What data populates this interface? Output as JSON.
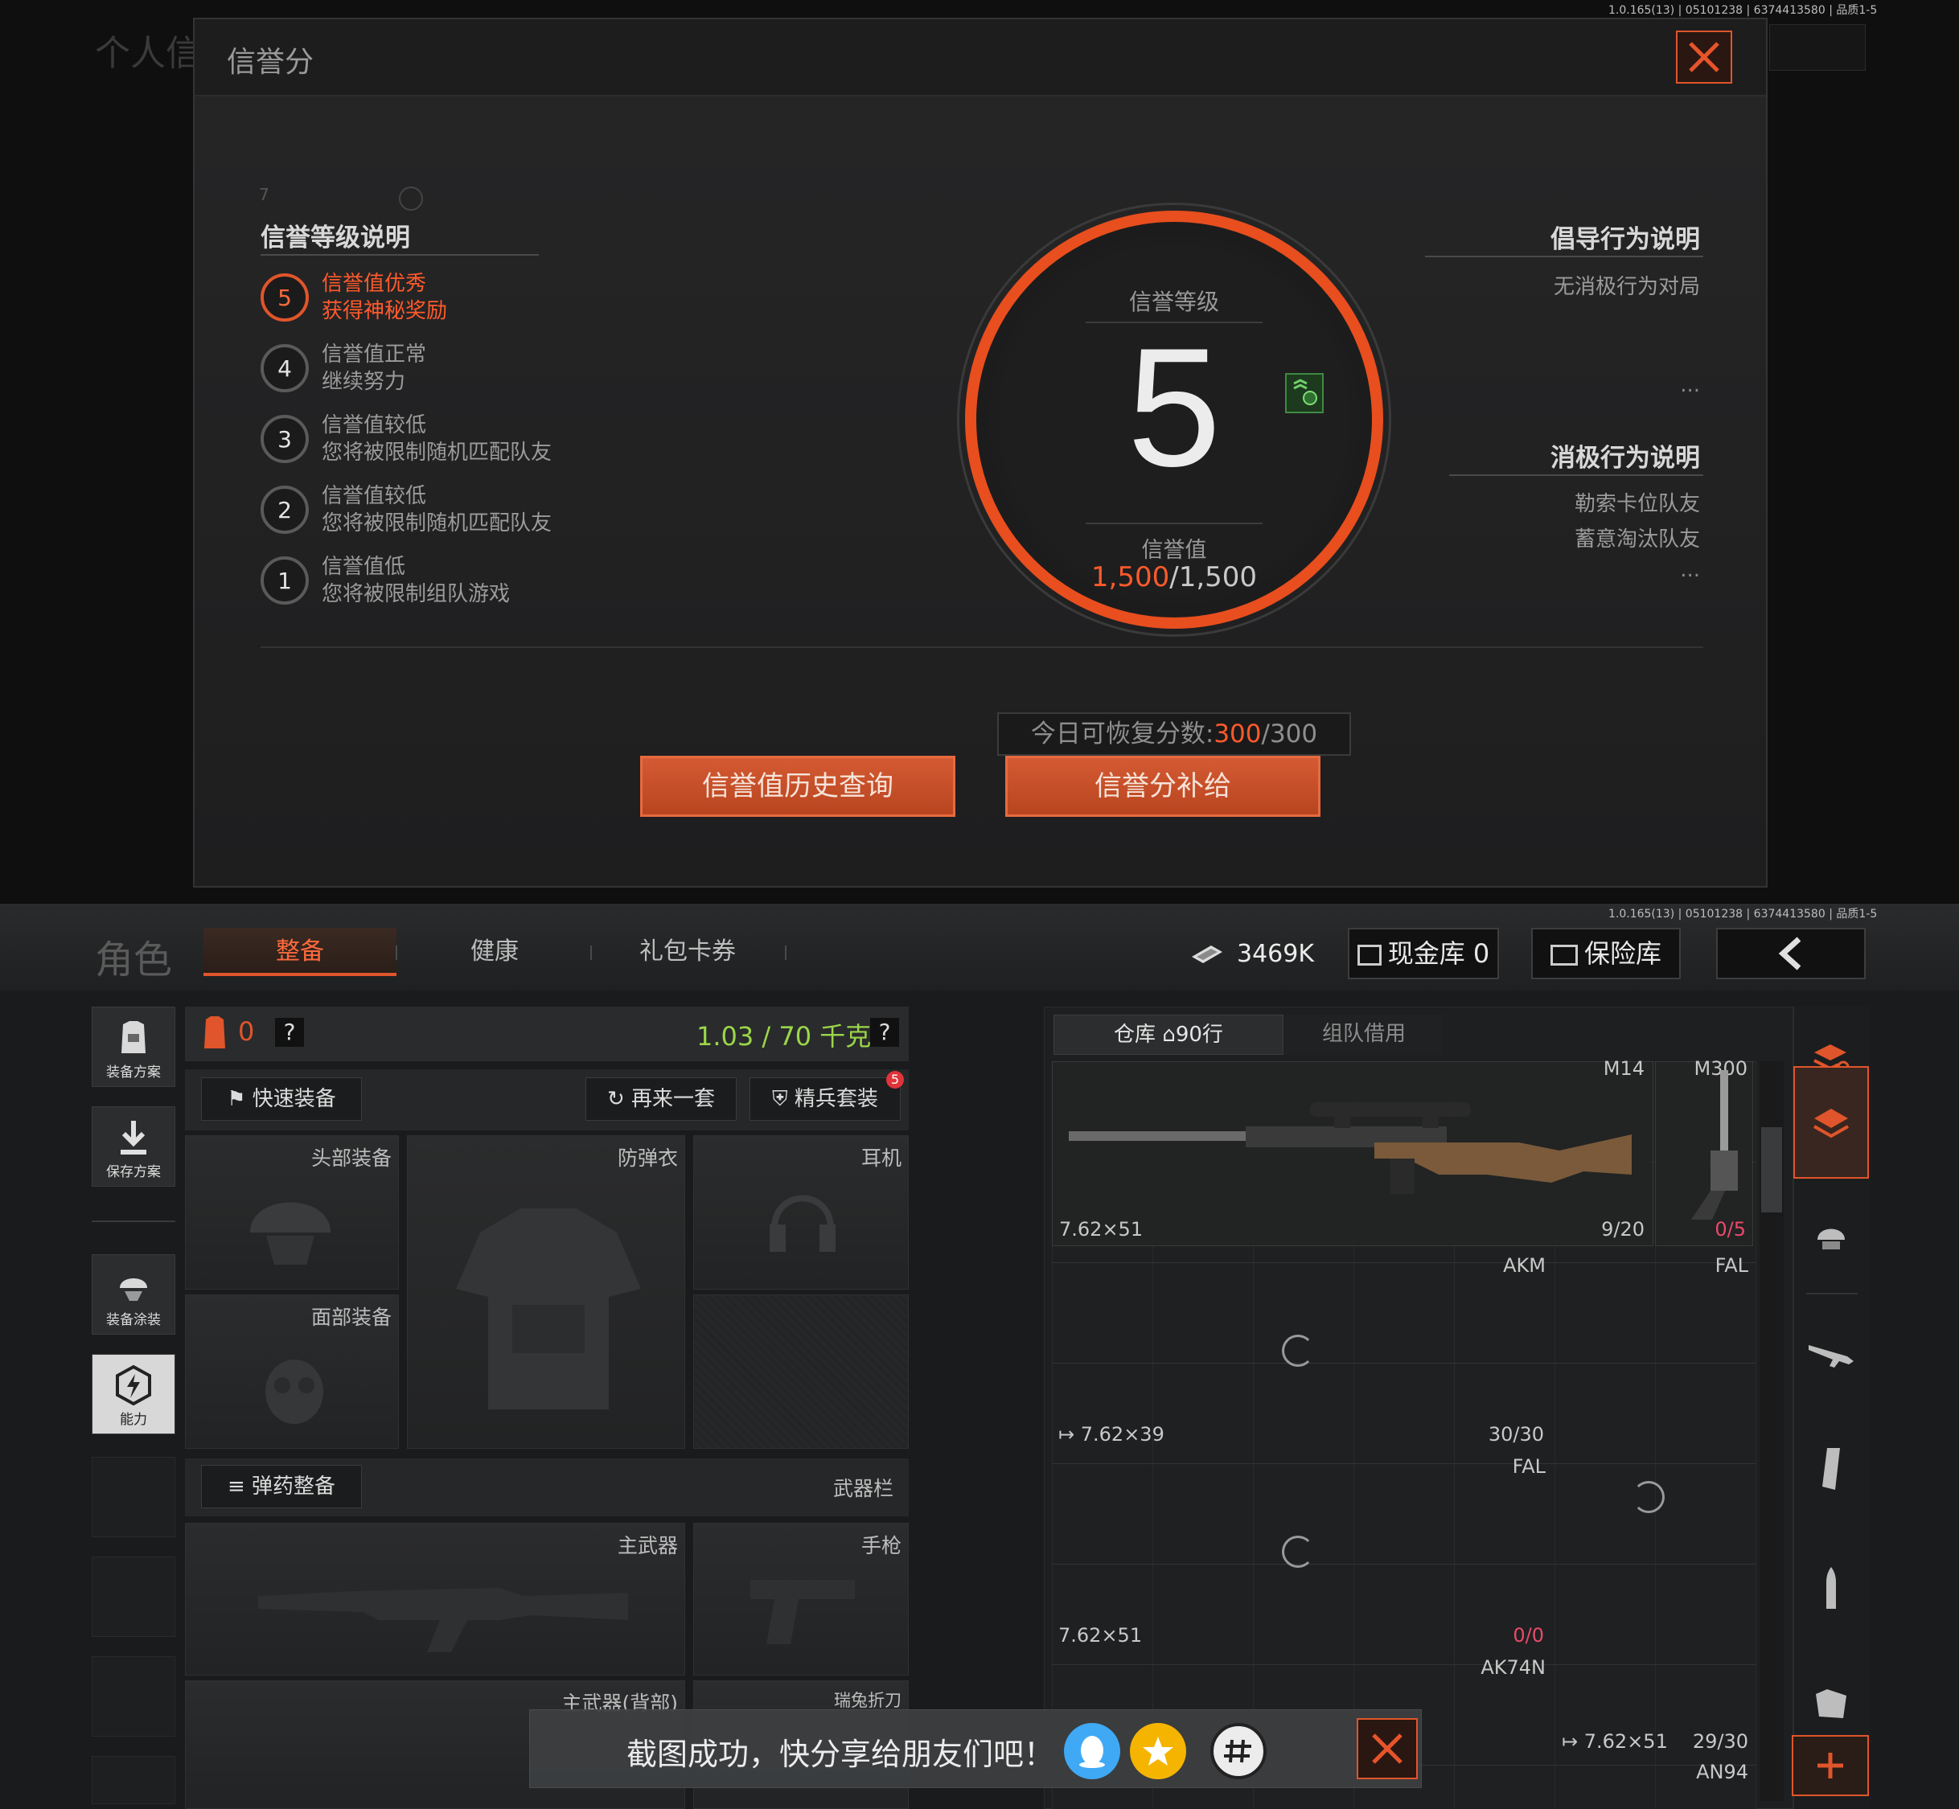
{
  "version_text": "1.0.165(13) | 05101238 | 6374413580 | 品质1-5",
  "top_screen": {
    "bg_title": "个人信",
    "dialog": {
      "title": "信誉分",
      "deco_small": "7",
      "levels_title": "信誉等级说明",
      "levels": [
        {
          "num": "5",
          "line1": "信誉值优秀",
          "line2": "获得神秘奖励",
          "active": true
        },
        {
          "num": "4",
          "line1": "信誉值正常",
          "line2": "继续努力",
          "active": false
        },
        {
          "num": "3",
          "line1": "信誉值较低",
          "line2": "您将被限制随机匹配队友",
          "active": false
        },
        {
          "num": "2",
          "line1": "信誉值较低",
          "line2": "您将被限制随机匹配队友",
          "active": false
        },
        {
          "num": "1",
          "line1": "信誉值低",
          "line2": "您将被限制组队游戏",
          "active": false
        }
      ],
      "center": {
        "level_label": "信誉等级",
        "level_value": "5",
        "score_label": "信誉值",
        "score_current": "1,500",
        "score_max": "/1,500"
      },
      "positive_title": "倡导行为说明",
      "positive_items": [
        "无消极行为对局"
      ],
      "negative_title": "消极行为说明",
      "negative_items": [
        "勒索卡位队友",
        "蓄意淘汰队友"
      ],
      "ellipsis": "...",
      "restore_label": "今日可恢复分数:",
      "restore_current": "300",
      "restore_max": "/300",
      "btn_history": "信誉值历史查询",
      "btn_supply": "信誉分补给"
    }
  },
  "bottom_screen": {
    "role_title": "角色",
    "tabs": [
      "整备",
      "健康",
      "礼包卡券"
    ],
    "money": "3469K",
    "cash_vault": "现金库 0",
    "safe_vault": "保险库",
    "sidebar": [
      {
        "label": "装备方案",
        "icon": "vest-icon"
      },
      {
        "label": "保存方案",
        "icon": "download-icon"
      },
      {
        "label": "装备涂装",
        "icon": "helmet-paint-icon"
      },
      {
        "label": "能力",
        "icon": "ability-icon"
      }
    ],
    "loadout": {
      "armor_count": "0",
      "help": "?",
      "weight": "1.03 / 70 千克",
      "quick_equip": "快速装备",
      "repeat_set": "再来一套",
      "elite_set": "精兵套装",
      "elite_badge": "5",
      "slots": {
        "head": "头部装备",
        "vest": "防弹衣",
        "ear": "耳机",
        "face": "面部装备"
      },
      "ammo_btn": "弹药整备",
      "weapon_bar": "武器栏",
      "primary": "主武器",
      "pistol": "手枪",
      "primary_back": "主武器(背部)",
      "knife": "瑞兔折刀"
    },
    "warehouse": {
      "tab_storage": "仓库",
      "rows": "90行",
      "tab_team": "组队借用",
      "items": [
        {
          "name": "M14",
          "caliber": "7.62×51",
          "count": "9/20"
        },
        {
          "name": "M300",
          "caliber": "",
          "count": "0/5"
        },
        {
          "name": "AKM",
          "caliber": "7.62×39",
          "count": "30/30"
        },
        {
          "name": "FAL",
          "caliber": "",
          "count": ""
        },
        {
          "name": "FAL",
          "caliber": "7.62×51",
          "count": "0/0"
        },
        {
          "name": "AK74N",
          "caliber": "",
          "count": ""
        },
        {
          "name": "AN94",
          "caliber": "7.62×51",
          "count": "29/30"
        }
      ]
    },
    "toast": {
      "text": "截图成功，快分享给朋友们吧！"
    },
    "colors": {
      "accent": "#e0552b",
      "green": "#9bd64a",
      "red_count": "#e84a6a"
    }
  }
}
